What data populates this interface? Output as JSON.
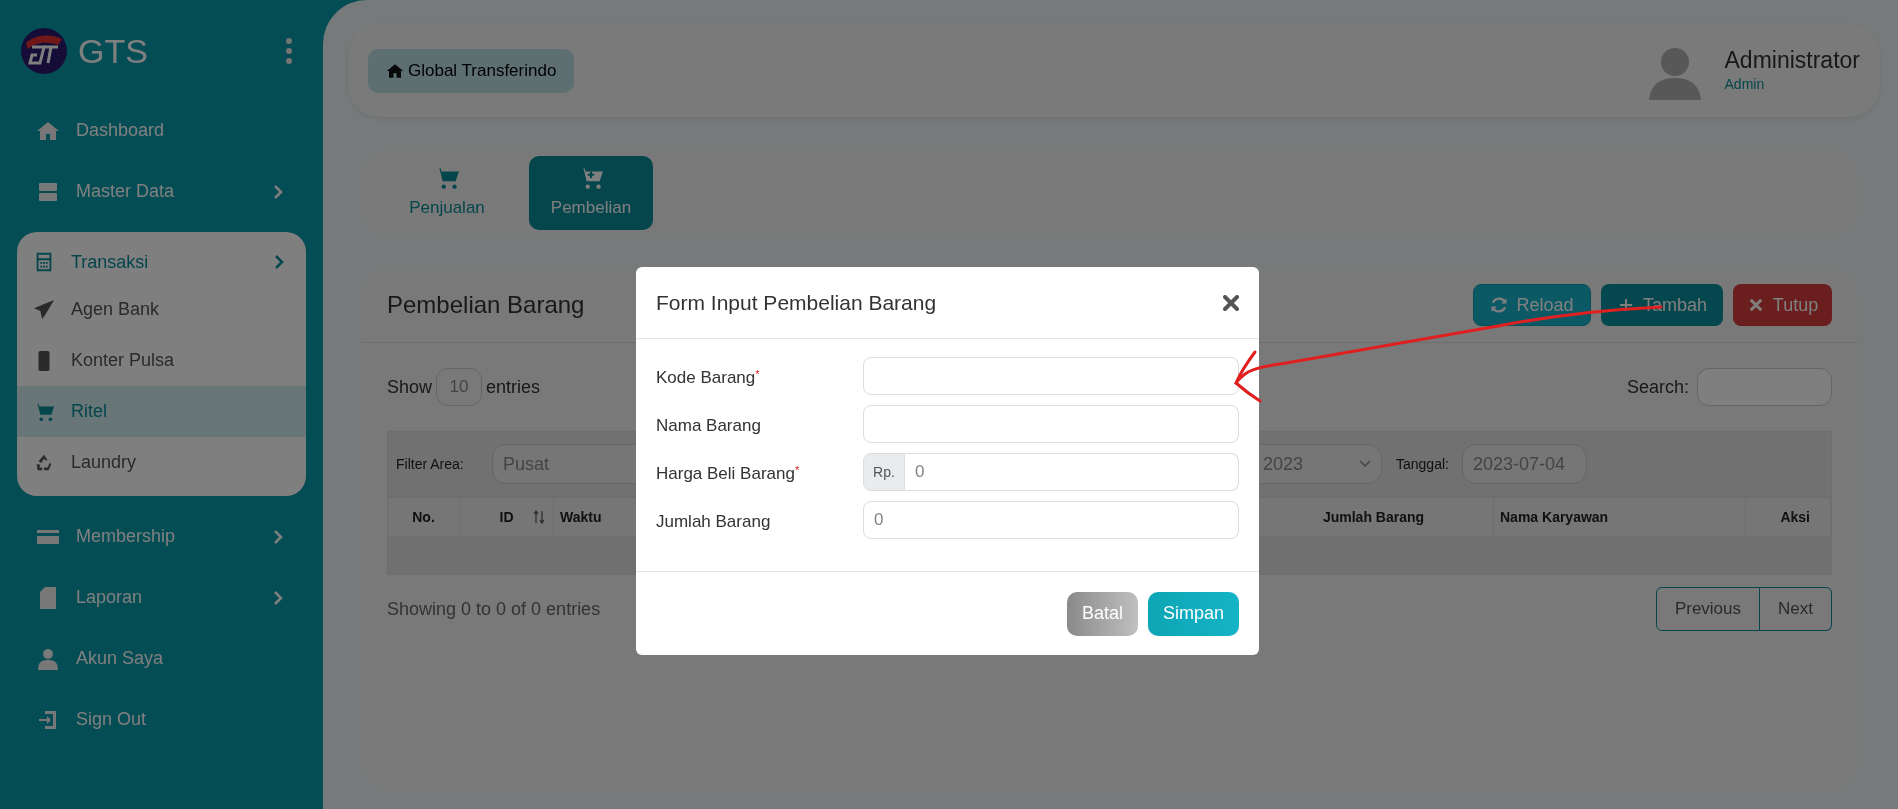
{
  "sidebar": {
    "brand": "GTS",
    "items": [
      {
        "label": "Dashboard",
        "has_submenu": false,
        "expanded": false
      },
      {
        "label": "Master Data",
        "has_submenu": true,
        "expanded": false
      },
      {
        "label": "Transaksi",
        "has_submenu": true,
        "expanded": true,
        "children": [
          {
            "label": "Agen Bank",
            "selected": false
          },
          {
            "label": "Konter Pulsa",
            "selected": false
          },
          {
            "label": "Ritel",
            "selected": true
          },
          {
            "label": "Laundry",
            "selected": false
          }
        ]
      },
      {
        "label": "Membership",
        "has_submenu": true,
        "expanded": false
      },
      {
        "label": "Laporan",
        "has_submenu": true,
        "expanded": false
      },
      {
        "label": "Akun Saya",
        "has_submenu": false,
        "expanded": false
      },
      {
        "label": "Sign Out",
        "has_submenu": false,
        "expanded": false
      }
    ]
  },
  "header": {
    "breadcrumb": "Global Transferindo",
    "user": {
      "name": "Administrator",
      "role": "Admin"
    }
  },
  "tabs": [
    {
      "label": "Penjualan",
      "selected": false
    },
    {
      "label": "Pembelian",
      "selected": true
    }
  ],
  "panel": {
    "title": "Pembelian Barang",
    "buttons": [
      {
        "label": "Reload",
        "kind": "reload"
      },
      {
        "label": "Tambah",
        "kind": "add"
      },
      {
        "label": "Tutup",
        "kind": "close"
      }
    ],
    "length": {
      "prefix": "Show",
      "value": "10",
      "suffix": "entries"
    },
    "search_label": "Search:",
    "filters": {
      "area_label": "Filter Area:",
      "area_value": "Pusat",
      "year_value": "2023",
      "date_label": "Tanggal:",
      "date_value": "2023-07-04"
    },
    "columns": [
      "No.",
      "ID",
      "Waktu",
      "Jumlah Barang",
      "Nama Karyawan",
      "Aksi"
    ],
    "info": "Showing 0 to 0 of 0 entries",
    "pagination": [
      "Previous",
      "Next"
    ]
  },
  "modal": {
    "title": "Form Input Pembelian Barang",
    "fields": [
      {
        "label": "Kode Barang$^{*}$",
        "kind": "text"
      },
      {
        "label": "Nama Barang",
        "kind": "text"
      },
      {
        "label": "Harga Beli Barang$^{*}$",
        "kind": "currency",
        "addon": "Rp.",
        "placeholder": "0"
      },
      {
        "label": "Jumlah Barang",
        "kind": "text",
        "placeholder": "0"
      }
    ],
    "buttons": [
      {
        "label": "Batal",
        "kind": "cancel"
      },
      {
        "label": "Simpan",
        "kind": "save"
      }
    ]
  }
}
